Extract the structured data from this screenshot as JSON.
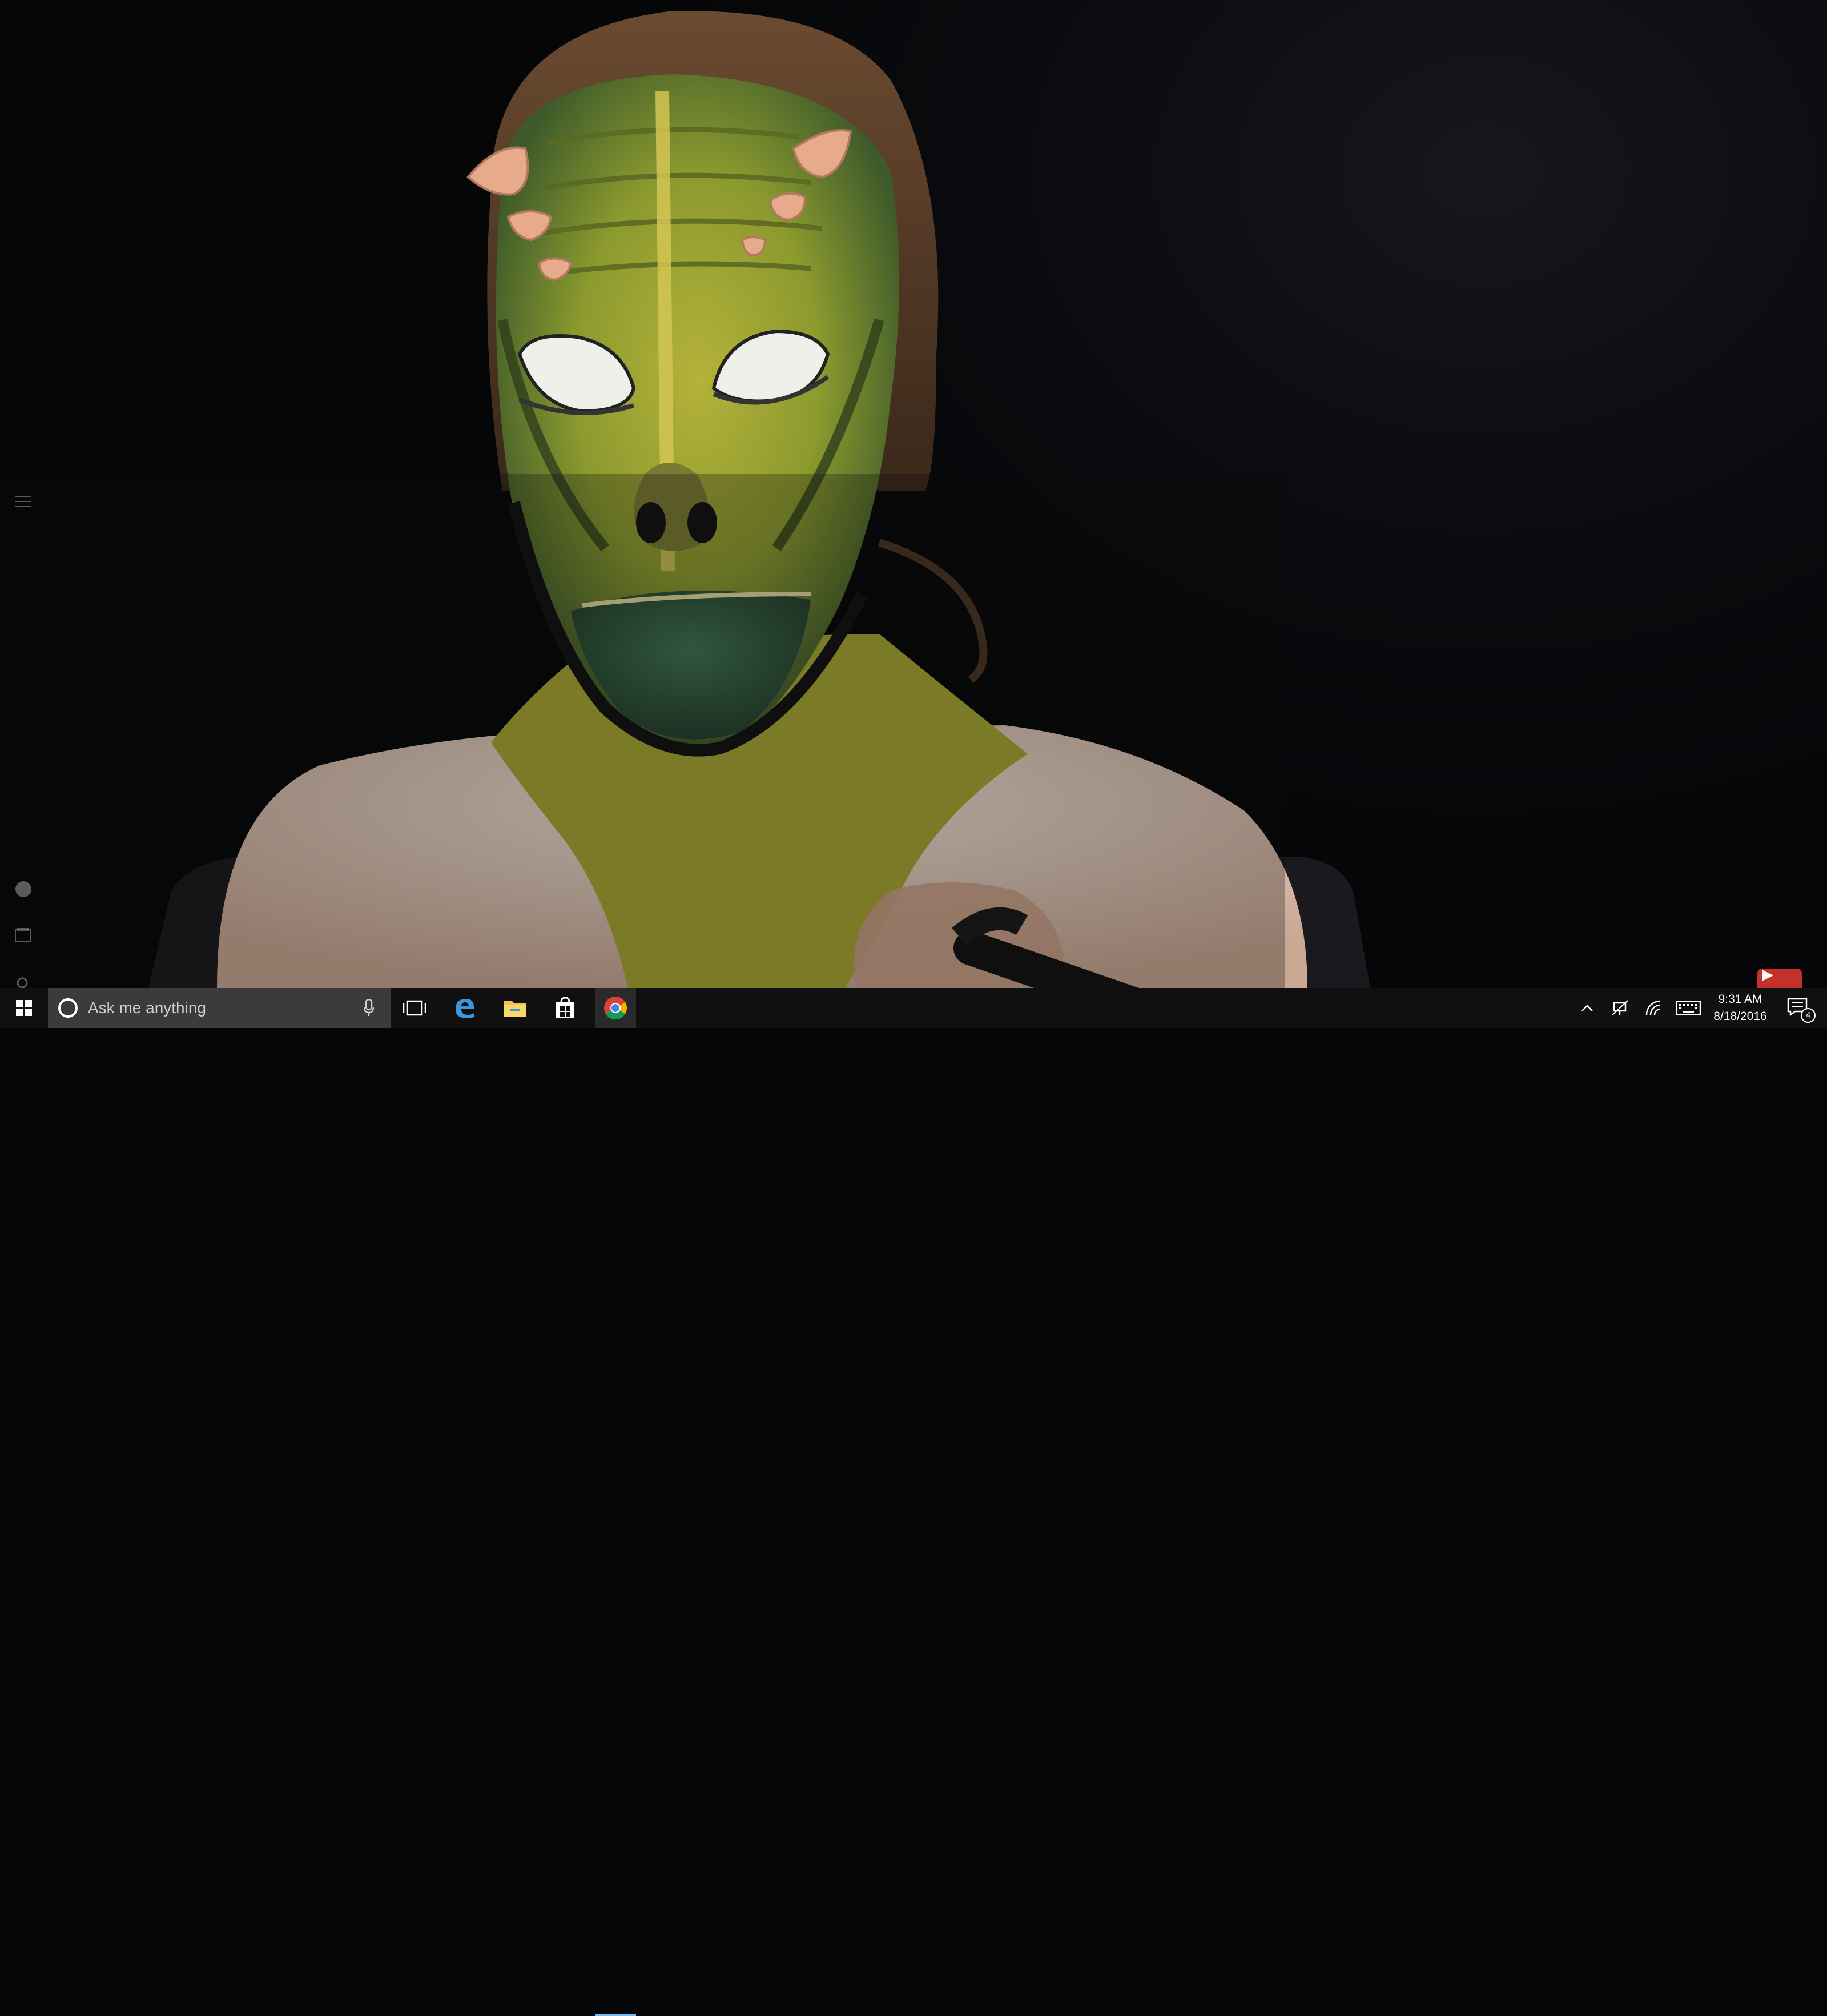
{
  "taskbar": {
    "search": {
      "placeholder": "Ask me anything"
    },
    "clock": {
      "time": "9:31 AM",
      "date": "8/18/2016"
    },
    "notifications": {
      "count": "4"
    },
    "pinned": [
      "start-icon",
      "task-view-icon",
      "edge-icon",
      "file-explorer-icon",
      "store-icon",
      "chrome-icon"
    ],
    "tray_icons": [
      "show-hidden-icons-chevron",
      "network-icon",
      "wifi-icon",
      "keyboard-icon",
      "action-center-icon"
    ]
  },
  "start_menu_ghost": {
    "icons": [
      "hamburger-menu-icon",
      "user-avatar-icon",
      "documents-icon",
      "settings-icon"
    ]
  },
  "video": {
    "subject": "person with green reptile face paint",
    "colors": {
      "skin_green": "#8a9a2a",
      "yellow_green": "#a8a536",
      "horn": "#e8a98a",
      "background": "#050608"
    }
  },
  "overlays": {
    "youtube_badge": "youtube-icon"
  }
}
